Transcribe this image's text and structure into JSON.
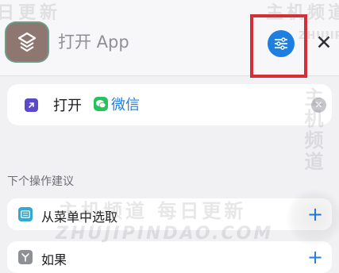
{
  "header": {
    "app_title": "打开 App",
    "settings_icon": "sliders-icon",
    "close_label": "✕",
    "accent_color": "#1f7fe0",
    "highlight_color": "#d32f37"
  },
  "action": {
    "verb": "打开",
    "app_name": "微信",
    "app_icon": "wechat-icon",
    "clear_label": "✕"
  },
  "suggestions": {
    "section_title": "下个操作建议",
    "items": [
      {
        "label": "从菜单中选取",
        "icon": "menu-icon",
        "add_label": "+"
      },
      {
        "label": "如果",
        "icon": "branch-icon",
        "add_label": "+"
      }
    ]
  },
  "watermarks": {
    "top_left": "日更新",
    "top_right": "主机频道",
    "site_small": "ZHUJIPINDAO",
    "vertical": "主机频道",
    "middle": "主机频道 每日更新",
    "site_large": "ZHUJIPINDAO.COM"
  }
}
